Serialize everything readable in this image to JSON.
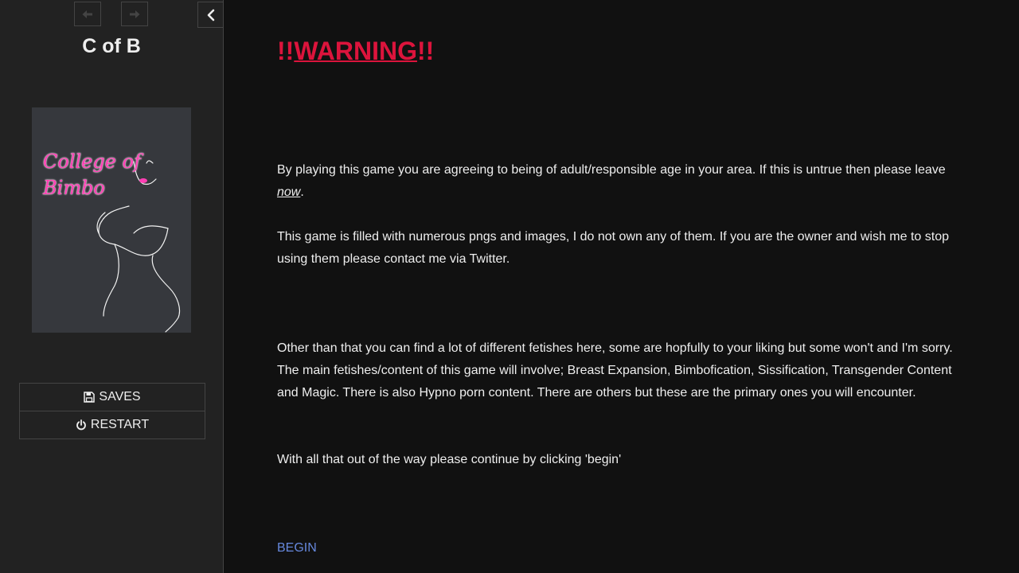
{
  "sidebar": {
    "story_title": "C of B",
    "cover": {
      "line1": "College of",
      "line2": "Bimbo"
    },
    "menu": {
      "saves_label": "SAVES",
      "restart_label": "RESTART"
    }
  },
  "passage": {
    "warning_prefix": "!!",
    "warning_word": "WARNING",
    "warning_suffix": "!!",
    "p1_text": "By playing this game you are agreeing to being of adult/responsible age in your area. If this is untrue then please leave ",
    "p1_emph": "now",
    "p1_end": ".",
    "p2": "This game is filled with numerous pngs and images, I do not own any of them. If you are the owner and wish me to stop using them please contact me via Twitter.",
    "p3": "Other than that you can find a lot of different fetishes here, some are hopfully to your liking but some won't and I'm sorry. The main fetishes/content of this game will involve; Breast Expansion, Bimbofication, Sissification, Transgender Content and Magic. There is also Hypno porn content. There are others but these are the primary ones you will encounter.",
    "p4": "With all that out of the way please continue by clicking 'begin'",
    "begin_link": "BEGIN"
  },
  "colors": {
    "warning": "#dc143c",
    "link": "#6688dd",
    "cover_text": "#ff3fb4"
  },
  "icons": [
    "arrow-left-icon",
    "arrow-right-icon",
    "chevron-left-icon",
    "save-icon",
    "power-icon"
  ]
}
